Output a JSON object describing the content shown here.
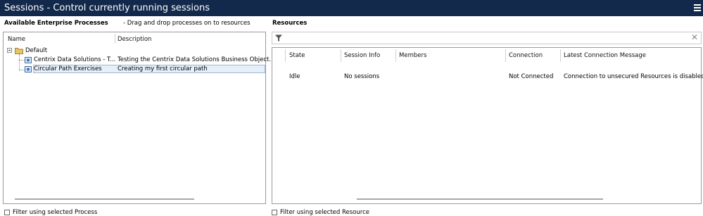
{
  "window": {
    "title": "Sessions - Control currently running sessions"
  },
  "left": {
    "heading": "Available Enterprise Processes",
    "hint": "- Drag and drop processes on to resources",
    "columns": {
      "name": "Name",
      "description": "Description"
    },
    "tree": {
      "group": "Default",
      "items": [
        {
          "name": "Centrix Data Solutions - T...",
          "description": "Testing the Centrix Data Solutions Business Object."
        },
        {
          "name": "Circular Path Exercises",
          "description": "Creating my first circular path"
        }
      ]
    },
    "filter_checkbox": "Filter using selected Process"
  },
  "right": {
    "heading": "Resources",
    "columns": {
      "state": "State",
      "session_info": "Session Info",
      "members": "Members",
      "connection": "Connection",
      "latest_message": "Latest Connection Message"
    },
    "rows": [
      {
        "state": "Idle",
        "session_info": "No sessions",
        "members": "",
        "connection": "Not Connected",
        "latest_message": "Connection to unsecured Resources is disabled"
      }
    ],
    "filter_checkbox": "Filter using selected Resource",
    "clear_filter_glyph": "✕"
  },
  "colors": {
    "titlebar": "#13294b",
    "selection": "#e6eef8"
  }
}
